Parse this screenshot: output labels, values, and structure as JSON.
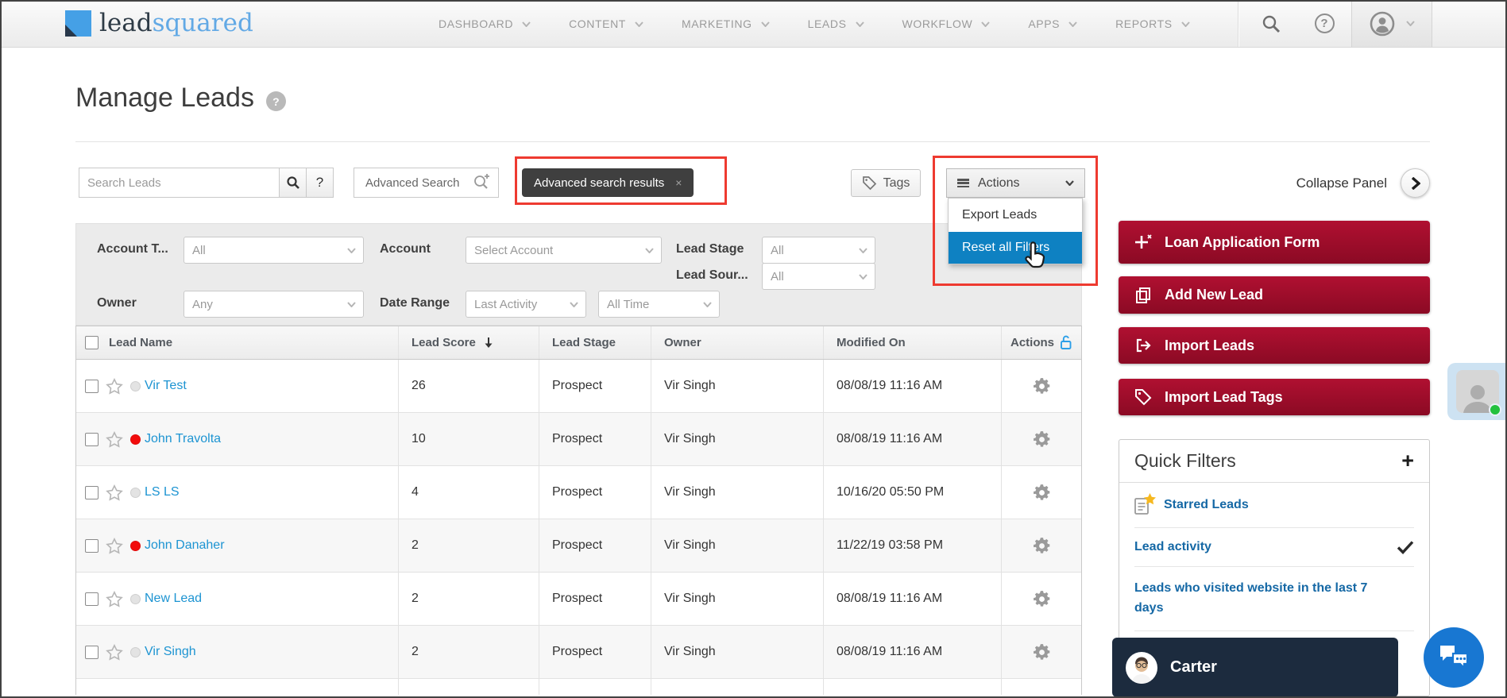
{
  "nav": {
    "logo_lead": "lead",
    "logo_squared": "squared",
    "items": [
      "DASHBOARD",
      "CONTENT",
      "MARKETING",
      "LEADS",
      "WORKFLOW",
      "APPS",
      "REPORTS"
    ],
    "help_glyph": "?"
  },
  "page": {
    "title": "Manage Leads",
    "help_glyph": "?"
  },
  "toolbar": {
    "search_placeholder": "Search Leads",
    "search_help": "?",
    "advanced_search": "Advanced Search",
    "results_chip": "Advanced search results",
    "chip_close": "×",
    "tags": "Tags",
    "actions": "Actions",
    "collapse_panel": "Collapse Panel"
  },
  "actions_menu": {
    "items": [
      "Export Leads",
      "Reset all Filters"
    ]
  },
  "filters": {
    "account_type_label": "Account T...",
    "account_type_value": "All",
    "account_label": "Account",
    "account_value": "Select Account",
    "lead_stage_label": "Lead Stage",
    "lead_stage_value": "All",
    "lead_source_label": "Lead Sour...",
    "lead_source_value": "All",
    "owner_label": "Owner",
    "owner_value": "Any",
    "date_range_label": "Date Range",
    "date_range_type": "Last Activity",
    "date_range_period": "All Time"
  },
  "table": {
    "headers": [
      "Lead Name",
      "Lead Score",
      "Lead Stage",
      "Owner",
      "Modified On",
      "Actions"
    ],
    "rows": [
      {
        "name": "Vir Test",
        "score": "26",
        "stage": "Prospect",
        "owner": "Vir Singh",
        "modified": "08/08/19 11:16 AM",
        "dot_style": "background:#e3e3e3;border:1px solid #cfcfcf"
      },
      {
        "name": "John Travolta",
        "score": "10",
        "stage": "Prospect",
        "owner": "Vir Singh",
        "modified": "08/08/19 11:16 AM",
        "dot_style": "background:#f20c0c;border:1px solid #e00b0b"
      },
      {
        "name": "LS LS",
        "score": "4",
        "stage": "Prospect",
        "owner": "Vir Singh",
        "modified": "10/16/20 05:50 PM",
        "dot_style": "background:#e3e3e3;border:1px solid #cfcfcf"
      },
      {
        "name": "John Danaher",
        "score": "2",
        "stage": "Prospect",
        "owner": "Vir Singh",
        "modified": "11/22/19 03:58 PM",
        "dot_style": "background:#f20c0c;border:1px solid #e00b0b"
      },
      {
        "name": "New Lead",
        "score": "2",
        "stage": "Prospect",
        "owner": "Vir Singh",
        "modified": "08/08/19 11:16 AM",
        "dot_style": "background:#e3e3e3;border:1px solid #cfcfcf"
      },
      {
        "name": "Vir Singh",
        "score": "2",
        "stage": "Prospect",
        "owner": "Vir Singh",
        "modified": "08/08/19 11:16 AM",
        "dot_style": "background:#e3e3e3;border:1px solid #cfcfcf"
      }
    ]
  },
  "sidebar": {
    "buttons": [
      "Loan Application Form",
      "Add New Lead",
      "Import Leads",
      "Import Lead Tags"
    ]
  },
  "quick_filters": {
    "title": "Quick Filters",
    "add_glyph": "+",
    "items": [
      "Starred Leads",
      "Lead activity",
      "Leads who visited website in the last 7 days"
    ]
  },
  "chat": {
    "agent_name": "Carter"
  },
  "colors": {
    "brand_red": "#a50d2d",
    "annotation_red": "#ee3a30",
    "menu_highlight_blue": "#0e81c2",
    "link_blue": "#1d94d2",
    "logo_blue": "#45a0e6",
    "chat_navy": "#1c2b3e",
    "chat_fab_blue": "#1877d2"
  }
}
